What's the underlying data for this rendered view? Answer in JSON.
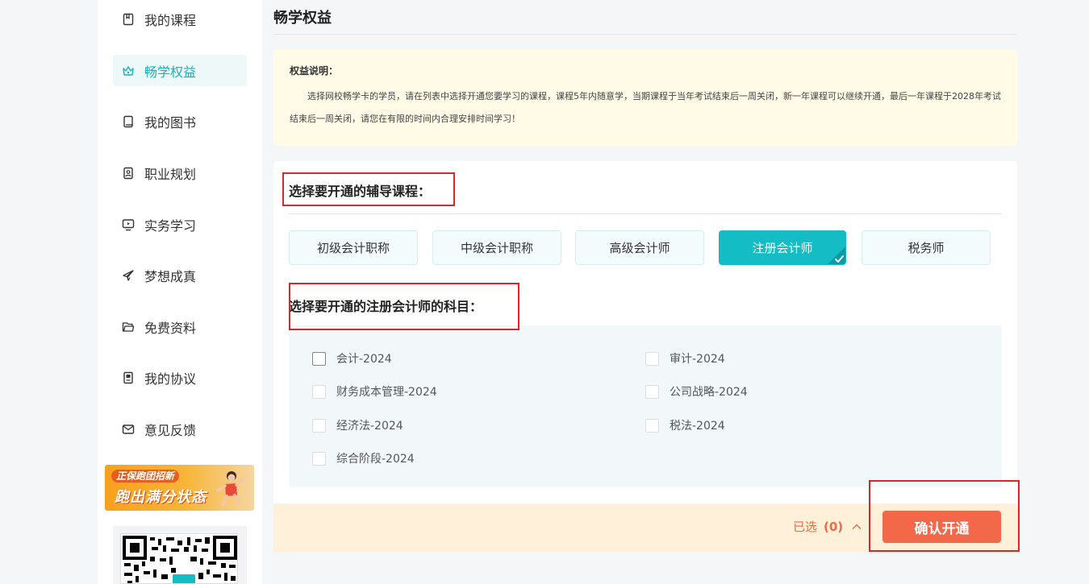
{
  "sidebar": {
    "items": [
      {
        "label": "我的课程",
        "icon": "book-icon",
        "active": false
      },
      {
        "label": "畅学权益",
        "icon": "crown-icon",
        "active": true
      },
      {
        "label": "我的图书",
        "icon": "notebook-icon",
        "active": false
      },
      {
        "label": "职业规划",
        "icon": "id-badge-icon",
        "active": false
      },
      {
        "label": "实务学习",
        "icon": "monitor-icon",
        "active": false
      },
      {
        "label": "梦想成真",
        "icon": "paper-plane-icon",
        "active": false
      },
      {
        "label": "免费资料",
        "icon": "folder-icon",
        "active": false
      },
      {
        "label": "我的协议",
        "icon": "document-icon",
        "active": false
      },
      {
        "label": "意见反馈",
        "icon": "mail-icon",
        "active": false
      }
    ],
    "promo": {
      "line1": "正保跑团招新",
      "line2": "跑出满分状态"
    }
  },
  "page": {
    "title": "畅学权益"
  },
  "notice": {
    "title": "权益说明：",
    "text": "选择网校畅学卡的学员，请在列表中选择开通您要学习的课程，课程5年内随意学，当期课程于当年考试结束后一周关闭，新一年课程可以继续开通，最后一年课程于2028年考试结束后一周关闭，请您在有限的时间内合理安排时间学习！"
  },
  "course_section": {
    "title": "选择要开通的辅导课程：",
    "tabs": [
      {
        "label": "初级会计职称",
        "selected": false
      },
      {
        "label": "中级会计职称",
        "selected": false
      },
      {
        "label": "高级会计师",
        "selected": false
      },
      {
        "label": "注册会计师",
        "selected": true
      },
      {
        "label": "税务师",
        "selected": false
      }
    ]
  },
  "subject_section": {
    "title": "选择要开通的注册会计师的科目：",
    "subjects": [
      {
        "label": "会计-2024",
        "checked": false
      },
      {
        "label": "审计-2024",
        "checked": false
      },
      {
        "label": "财务成本管理-2024",
        "checked": false
      },
      {
        "label": "公司战略-2024",
        "checked": false
      },
      {
        "label": "经济法-2024",
        "checked": false
      },
      {
        "label": "税法-2024",
        "checked": false
      },
      {
        "label": "综合阶段-2024",
        "checked": false
      }
    ]
  },
  "footer": {
    "selected_label": "已选",
    "selected_count": "(0)",
    "confirm_label": "确认开通"
  },
  "colors": {
    "accent": "#14bcc6",
    "confirm": "#f4684a",
    "notice_bg": "#fffbe6",
    "annotation": "#e0222a"
  }
}
